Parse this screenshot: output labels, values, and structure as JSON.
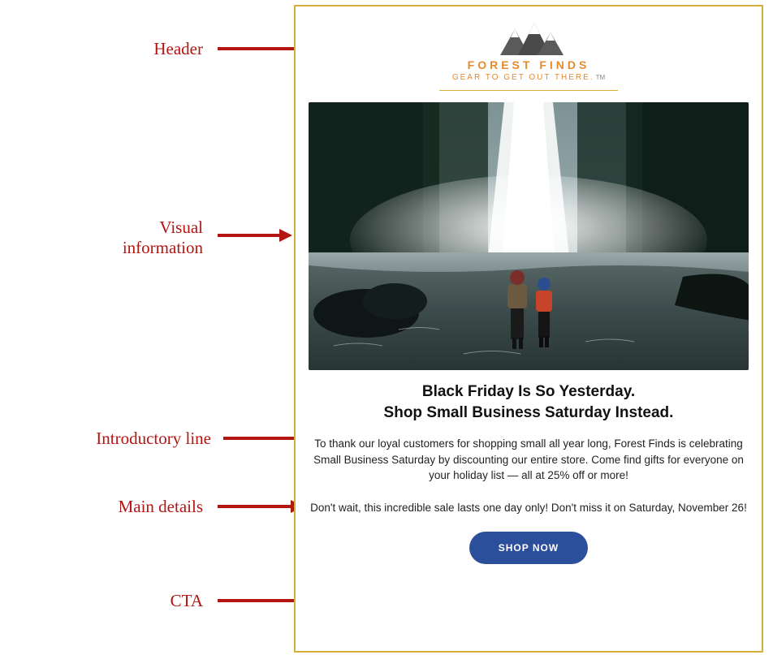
{
  "annotations": {
    "header": "Header",
    "visual_line1": "Visual",
    "visual_line2": "information",
    "intro": "Introductory line",
    "details": "Main details",
    "cta": "CTA"
  },
  "brand": {
    "name": "FOREST FINDS",
    "tagline": "GEAR TO GET OUT THERE.",
    "tm": "TM"
  },
  "headline": {
    "line1": "Black Friday Is So Yesterday.",
    "line2": "Shop Small Business Saturday Instead."
  },
  "body": "To thank our loyal customers for shopping small all year long, Forest Finds is celebrating Small Business Saturday by discounting our entire store. Come find gifts for everyone on your holiday list — all at 25% off or more!",
  "urgency": "Don't wait, this incredible sale lasts one day only! Don't miss it on Saturday, November 26!",
  "cta_label": "SHOP NOW",
  "colors": {
    "accent": "#b31512",
    "gold": "#d4b03a",
    "orange": "#e68a2e",
    "navy": "#2c4f9c"
  }
}
